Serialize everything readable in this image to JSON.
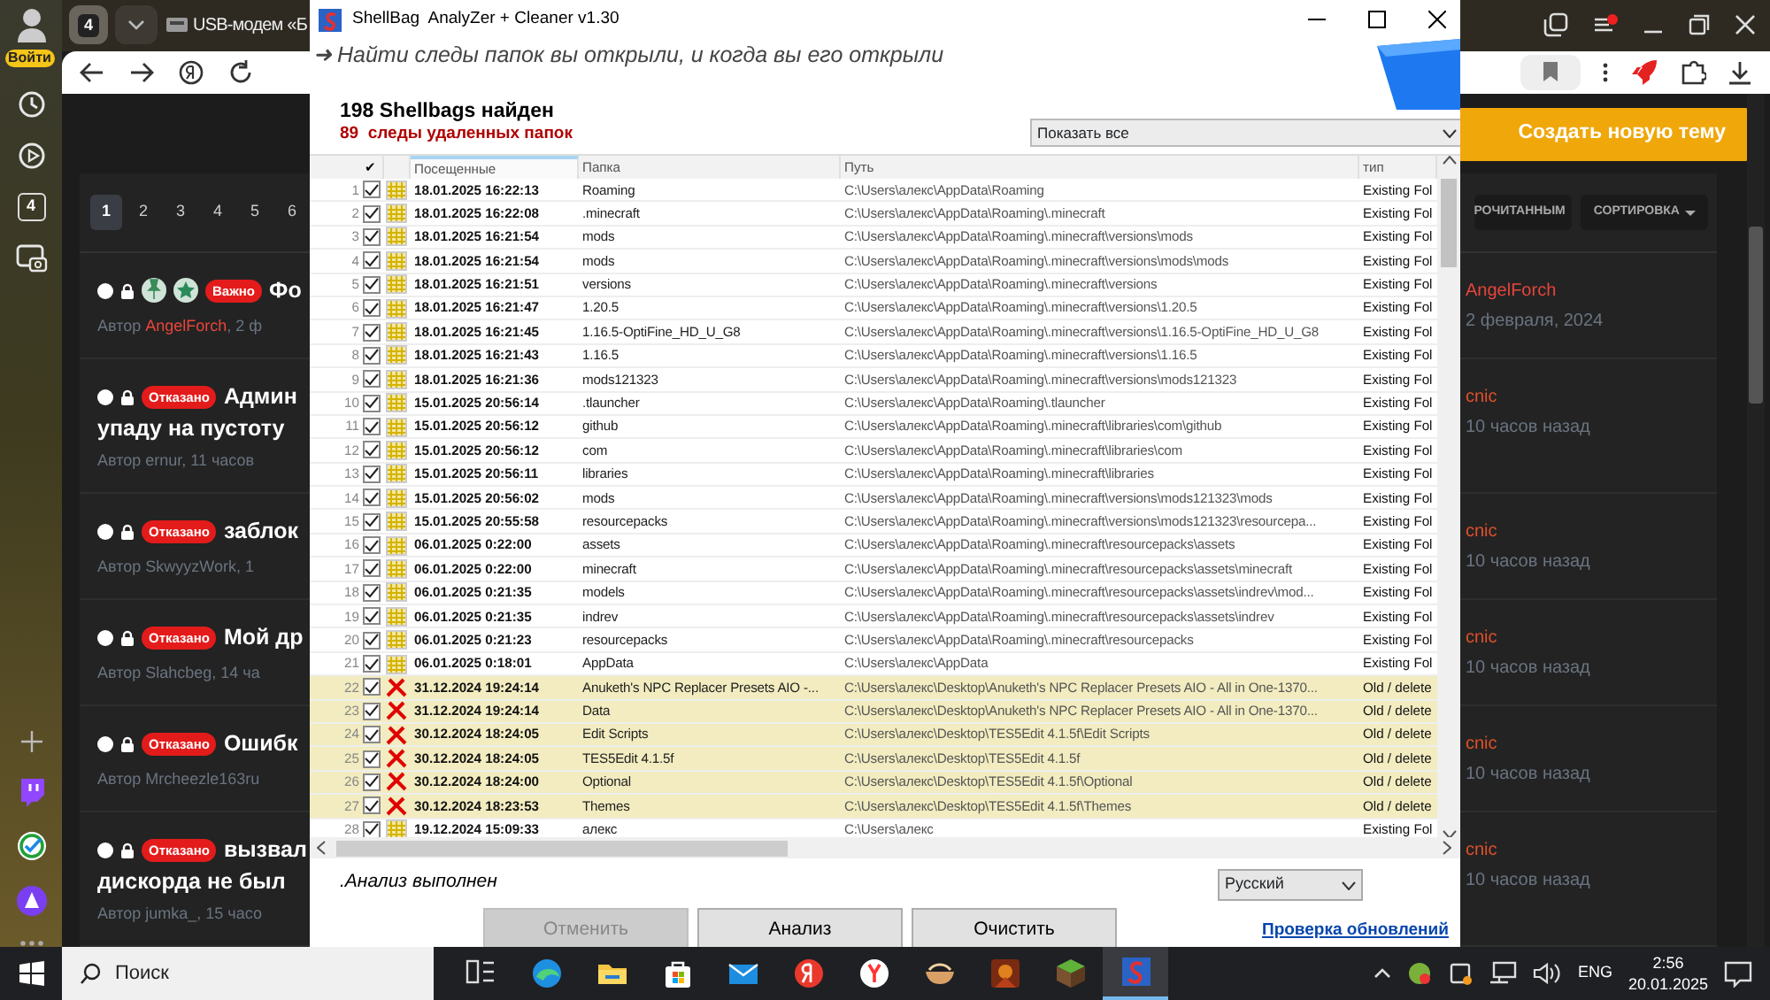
{
  "browser": {
    "profile_badge": "Войти",
    "sidebar_count": "4",
    "tab_count": "4",
    "tab_title": "USB-модем «Б"
  },
  "forum": {
    "new_topic_button": "Создать новую тему",
    "mark_read_button": "РОЧИТАННЫМ",
    "sort_button": "СОРТИРОВКА",
    "pages": [
      {
        "label": "1",
        "selected": true
      },
      {
        "label": "2",
        "selected": false
      },
      {
        "label": "3",
        "selected": false
      },
      {
        "label": "4",
        "selected": false
      },
      {
        "label": "5",
        "selected": false
      },
      {
        "label": "6",
        "selected": false
      }
    ],
    "topics": [
      {
        "markers": [
          {
            "kind": "pin"
          },
          {
            "kind": "star"
          }
        ],
        "status": "Важно",
        "title_lines": [
          "Фо"
        ],
        "meta_prefix": "Автор ",
        "author": "AngelForch",
        "author_highlight": true,
        "meta_suffix": ", 2 ф",
        "last_author": "AngelForch",
        "color": "#e8453c",
        "last_time": "2 февраля, 2024"
      },
      {
        "status": "Отказано",
        "title_lines": [
          "Админ",
          "упаду на пустоту"
        ],
        "meta_prefix": "Автор ",
        "author": "ernur",
        "author_highlight": false,
        "meta_suffix": ", 11 часов",
        "last_author": "cnic",
        "color": "#e0512a",
        "last_time": "10 часов назад"
      },
      {
        "status": "Отказано",
        "title_lines": [
          "заблок"
        ],
        "meta_prefix": "Автор ",
        "author": "SkwyyzWork",
        "author_highlight": false,
        "meta_suffix": ", 1",
        "last_author": "cnic",
        "color": "#e0512a",
        "last_time": "10 часов назад"
      },
      {
        "status": "Отказано",
        "title_lines": [
          "Мой др"
        ],
        "meta_prefix": "Автор ",
        "author": "Slahcbeg",
        "author_highlight": false,
        "meta_suffix": ", 14 ча",
        "last_author": "cnic",
        "color": "#e0512a",
        "last_time": "10 часов назад"
      },
      {
        "status": "Отказано",
        "title_lines": [
          "Ошибк"
        ],
        "meta_prefix": "Автор ",
        "author": "Mrcheezle163ru",
        "author_highlight": false,
        "last_author": "cnic",
        "color": "#e0512a",
        "last_time": "10 часов назад"
      },
      {
        "status": "Отказано",
        "title_lines": [
          "вызвал",
          "дискорда не был"
        ],
        "meta_prefix": "Автор ",
        "author": "jumka_",
        "author_highlight": false,
        "meta_suffix": ", 15 часо",
        "last_author": "cnic",
        "color": "#e0512a",
        "last_time": "10 часов назад"
      }
    ]
  },
  "window": {
    "title": "ShellBag  AnalyZer + Cleaner v1.30",
    "tagline": "➜ Найти следы папок вы открыли, и когда вы его открыли",
    "found_count": "198 Shellbags найден",
    "deleted_count": "89  следы удаленных папок",
    "filter": "Показать все",
    "columns": [
      {
        "label": "✔",
        "sorted": false
      },
      {
        "label": "Посещенные",
        "sorted": true
      },
      {
        "label": "Папка",
        "sorted": false
      },
      {
        "label": "Путь",
        "sorted": false
      },
      {
        "label": "тип",
        "sorted": false
      }
    ],
    "rows": [
      {
        "num": "1",
        "checked": true,
        "deleted": false,
        "visited": "18.01.2025 16:22:13",
        "folder": "Roaming",
        "path": "C:\\Users\\алекс\\AppData\\Roaming",
        "type": "Existing Fol"
      },
      {
        "num": "2",
        "checked": true,
        "deleted": false,
        "visited": "18.01.2025 16:22:08",
        "folder": ".minecraft",
        "path": "C:\\Users\\алекс\\AppData\\Roaming\\.minecraft",
        "type": "Existing Fol"
      },
      {
        "num": "3",
        "checked": true,
        "deleted": false,
        "visited": "18.01.2025 16:21:54",
        "folder": "mods",
        "path": "C:\\Users\\алекс\\AppData\\Roaming\\.minecraft\\versions\\mods",
        "type": "Existing Fol"
      },
      {
        "num": "4",
        "checked": true,
        "deleted": false,
        "visited": "18.01.2025 16:21:54",
        "folder": "mods",
        "path": "C:\\Users\\алекс\\AppData\\Roaming\\.minecraft\\versions\\mods\\mods",
        "type": "Existing Fol"
      },
      {
        "num": "5",
        "checked": true,
        "deleted": false,
        "visited": "18.01.2025 16:21:51",
        "folder": "versions",
        "path": "C:\\Users\\алекс\\AppData\\Roaming\\.minecraft\\versions",
        "type": "Existing Fol"
      },
      {
        "num": "6",
        "checked": true,
        "deleted": false,
        "visited": "18.01.2025 16:21:47",
        "folder": "1.20.5",
        "path": "C:\\Users\\алекс\\AppData\\Roaming\\.minecraft\\versions\\1.20.5",
        "type": "Existing Fol"
      },
      {
        "num": "7",
        "checked": true,
        "deleted": false,
        "visited": "18.01.2025 16:21:45",
        "folder": "1.16.5-OptiFine_HD_U_G8",
        "path": "C:\\Users\\алекс\\AppData\\Roaming\\.minecraft\\versions\\1.16.5-OptiFine_HD_U_G8",
        "type": "Existing Fol"
      },
      {
        "num": "8",
        "checked": true,
        "deleted": false,
        "visited": "18.01.2025 16:21:43",
        "folder": "1.16.5",
        "path": "C:\\Users\\алекс\\AppData\\Roaming\\.minecraft\\versions\\1.16.5",
        "type": "Existing Fol"
      },
      {
        "num": "9",
        "checked": true,
        "deleted": false,
        "visited": "18.01.2025 16:21:36",
        "folder": "mods121323",
        "path": "C:\\Users\\алекс\\AppData\\Roaming\\.minecraft\\versions\\mods121323",
        "type": "Existing Fol"
      },
      {
        "num": "10",
        "checked": true,
        "deleted": false,
        "visited": "15.01.2025 20:56:14",
        "folder": ".tlauncher",
        "path": "C:\\Users\\алекс\\AppData\\Roaming\\.tlauncher",
        "type": "Existing Fol"
      },
      {
        "num": "11",
        "checked": true,
        "deleted": false,
        "visited": "15.01.2025 20:56:12",
        "folder": "github",
        "path": "C:\\Users\\алекс\\AppData\\Roaming\\.minecraft\\libraries\\com\\github",
        "type": "Existing Fol"
      },
      {
        "num": "12",
        "checked": true,
        "deleted": false,
        "visited": "15.01.2025 20:56:12",
        "folder": "com",
        "path": "C:\\Users\\алекс\\AppData\\Roaming\\.minecraft\\libraries\\com",
        "type": "Existing Fol"
      },
      {
        "num": "13",
        "checked": true,
        "deleted": false,
        "visited": "15.01.2025 20:56:11",
        "folder": "libraries",
        "path": "C:\\Users\\алекс\\AppData\\Roaming\\.minecraft\\libraries",
        "type": "Existing Fol"
      },
      {
        "num": "14",
        "checked": true,
        "deleted": false,
        "visited": "15.01.2025 20:56:02",
        "folder": "mods",
        "path": "C:\\Users\\алекс\\AppData\\Roaming\\.minecraft\\versions\\mods121323\\mods",
        "type": "Existing Fol"
      },
      {
        "num": "15",
        "checked": true,
        "deleted": false,
        "visited": "15.01.2025 20:55:58",
        "folder": "resourcepacks",
        "path": "C:\\Users\\алекс\\AppData\\Roaming\\.minecraft\\versions\\mods121323\\resourcepa...",
        "type": "Existing Fol"
      },
      {
        "num": "16",
        "checked": true,
        "deleted": false,
        "visited": "06.01.2025 0:22:00",
        "folder": "assets",
        "path": "C:\\Users\\алекс\\AppData\\Roaming\\.minecraft\\resourcepacks\\assets",
        "type": "Existing Fol"
      },
      {
        "num": "17",
        "checked": true,
        "deleted": false,
        "visited": "06.01.2025 0:22:00",
        "folder": "minecraft",
        "path": "C:\\Users\\алекс\\AppData\\Roaming\\.minecraft\\resourcepacks\\assets\\minecraft",
        "type": "Existing Fol"
      },
      {
        "num": "18",
        "checked": true,
        "deleted": false,
        "visited": "06.01.2025 0:21:35",
        "folder": "models",
        "path": "C:\\Users\\алекс\\AppData\\Roaming\\.minecraft\\resourcepacks\\assets\\indrev\\mod...",
        "type": "Existing Fol"
      },
      {
        "num": "19",
        "checked": true,
        "deleted": false,
        "visited": "06.01.2025 0:21:35",
        "folder": "indrev",
        "path": "C:\\Users\\алекс\\AppData\\Roaming\\.minecraft\\resourcepacks\\assets\\indrev",
        "type": "Existing Fol"
      },
      {
        "num": "20",
        "checked": true,
        "deleted": false,
        "visited": "06.01.2025 0:21:23",
        "folder": "resourcepacks",
        "path": "C:\\Users\\алекс\\AppData\\Roaming\\.minecraft\\resourcepacks",
        "type": "Existing Fol"
      },
      {
        "num": "21",
        "checked": true,
        "deleted": false,
        "visited": "06.01.2025 0:18:01",
        "folder": "AppData",
        "path": "C:\\Users\\алекс\\AppData",
        "type": "Existing Fol"
      },
      {
        "num": "22",
        "checked": true,
        "deleted": true,
        "visited": "31.12.2024 19:24:14",
        "folder": "Anuketh's NPC Replacer Presets AIO -...",
        "path": "C:\\Users\\алекс\\Desktop\\Anuketh's NPC Replacer Presets AIO - All in One-1370...",
        "type": "Old / delete"
      },
      {
        "num": "23",
        "checked": true,
        "deleted": true,
        "visited": "31.12.2024 19:24:14",
        "folder": "Data",
        "path": "C:\\Users\\алекс\\Desktop\\Anuketh's NPC Replacer Presets AIO - All in One-1370...",
        "type": "Old / delete"
      },
      {
        "num": "24",
        "checked": true,
        "deleted": true,
        "visited": "30.12.2024 18:24:05",
        "folder": "Edit Scripts",
        "path": "C:\\Users\\алекс\\Desktop\\TES5Edit 4.1.5f\\Edit Scripts",
        "type": "Old / delete"
      },
      {
        "num": "25",
        "checked": true,
        "deleted": true,
        "visited": "30.12.2024 18:24:05",
        "folder": "TES5Edit 4.1.5f",
        "path": "C:\\Users\\алекс\\Desktop\\TES5Edit 4.1.5f",
        "type": "Old / delete"
      },
      {
        "num": "26",
        "checked": true,
        "deleted": true,
        "visited": "30.12.2024 18:24:00",
        "folder": "Optional",
        "path": "C:\\Users\\алекс\\Desktop\\TES5Edit 4.1.5f\\Optional",
        "type": "Old / delete"
      },
      {
        "num": "27",
        "checked": true,
        "deleted": true,
        "visited": "30.12.2024 18:23:53",
        "folder": "Themes",
        "path": "C:\\Users\\алекс\\Desktop\\TES5Edit 4.1.5f\\Themes",
        "type": "Old / delete"
      },
      {
        "num": "28",
        "checked": true,
        "deleted": false,
        "visited": "19.12.2024 15:09:33",
        "folder": "алекс",
        "path": "C:\\Users\\алекс",
        "type": "Existing Fol"
      }
    ],
    "status": ".Анализ выполнен",
    "language": "Русский",
    "buttons": [
      {
        "label": "Отменить",
        "disabled": true
      },
      {
        "label": "Анализ",
        "disabled": false
      },
      {
        "label": "Очистить",
        "disabled": false
      }
    ],
    "update_link": "Проверка обновлений"
  },
  "taskbar": {
    "search_placeholder": "Поиск",
    "language": "ENG",
    "time": "2:56",
    "date": "20.01.2025"
  }
}
